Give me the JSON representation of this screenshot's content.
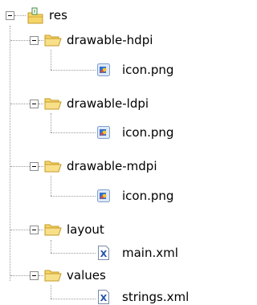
{
  "tree": {
    "root": {
      "label": "res",
      "icon": "resource-folder-icon"
    },
    "folders": [
      {
        "label": "drawable-hdpi",
        "file": {
          "label": "icon.png",
          "icon": "png-image-icon"
        }
      },
      {
        "label": "drawable-ldpi",
        "file": {
          "label": "icon.png",
          "icon": "png-image-icon"
        }
      },
      {
        "label": "drawable-mdpi",
        "file": {
          "label": "icon.png",
          "icon": "png-image-icon"
        }
      },
      {
        "label": "layout",
        "file": {
          "label": "main.xml",
          "icon": "xml-file-icon"
        }
      },
      {
        "label": "values",
        "file": {
          "label": "strings.xml",
          "icon": "xml-file-icon"
        }
      }
    ]
  },
  "colors": {
    "folder_fill": "#f5d56a",
    "folder_stroke": "#c69a24",
    "tree_lines": "#9a9a9a",
    "png_blue": "#2f6fd0",
    "xml_blue": "#1f4fa8"
  }
}
